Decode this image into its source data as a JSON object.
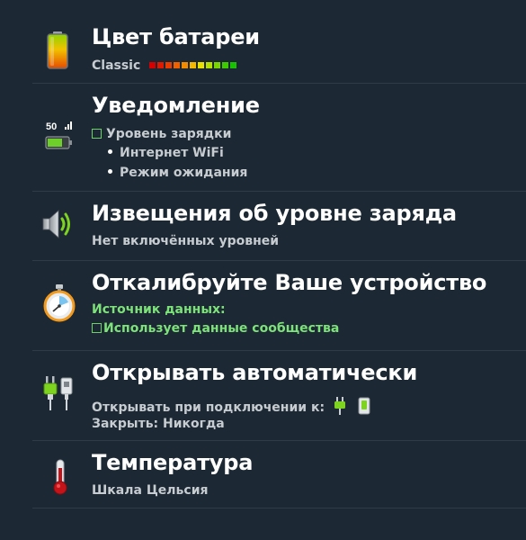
{
  "settings": [
    {
      "title": "Цвет батареи",
      "icon": "battery-color-icon",
      "style_label": "Classic",
      "colors": [
        "#d60000",
        "#e01a00",
        "#e83c00",
        "#f06000",
        "#f38a00",
        "#f5b800",
        "#e8e000",
        "#b6e000",
        "#7ad400",
        "#3ecb00",
        "#19c200"
      ]
    },
    {
      "title": "Уведомление",
      "icon": "notification-battery-icon",
      "icon_label": "50",
      "checkbox_label": "Уровень зарядки",
      "bullets": [
        "Интернет WiFi",
        "Режим ожидания"
      ]
    },
    {
      "title": "Извещения об уровне заряда",
      "icon": "speaker-icon",
      "subtitle": "Нет включённых уровней"
    },
    {
      "title": "Откалибруйте Ваше устройство",
      "icon": "stopwatch-icon",
      "source_label": "Источник данных:",
      "checkbox_label": "Использует данные сообщества"
    },
    {
      "title": "Открывать автоматически",
      "icon": "plug-icon",
      "open_label": "Открывать при подключении к:",
      "close_label": "Закрыть: Никогда"
    },
    {
      "title": "Температура",
      "icon": "thermometer-icon",
      "subtitle": "Шкала Цельсия"
    }
  ]
}
